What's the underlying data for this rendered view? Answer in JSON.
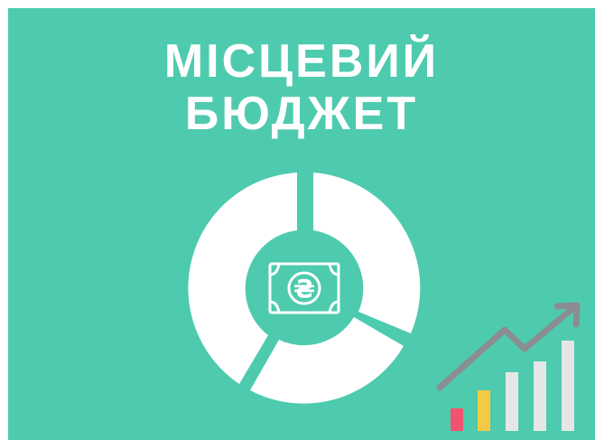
{
  "title": {
    "line1": "МІСЦЕВИЙ",
    "line2": "БЮДЖЕТ"
  },
  "center_icon": {
    "name": "banknote-hryvnia-icon",
    "symbol": "₴"
  },
  "donut_graphic": {
    "name": "donut-chart-icon",
    "segments": 3,
    "color": "#ffffff"
  },
  "growth_graphic": {
    "name": "growth-bar-chart-icon",
    "bar_colors": [
      "#f2536f",
      "#f6c945",
      "#e6e6e6",
      "#e6e6e6",
      "#e6e6e6"
    ],
    "arrow_color": "#8a8d92"
  },
  "colors": {
    "background": "#4ecbae",
    "text": "#ffffff"
  }
}
